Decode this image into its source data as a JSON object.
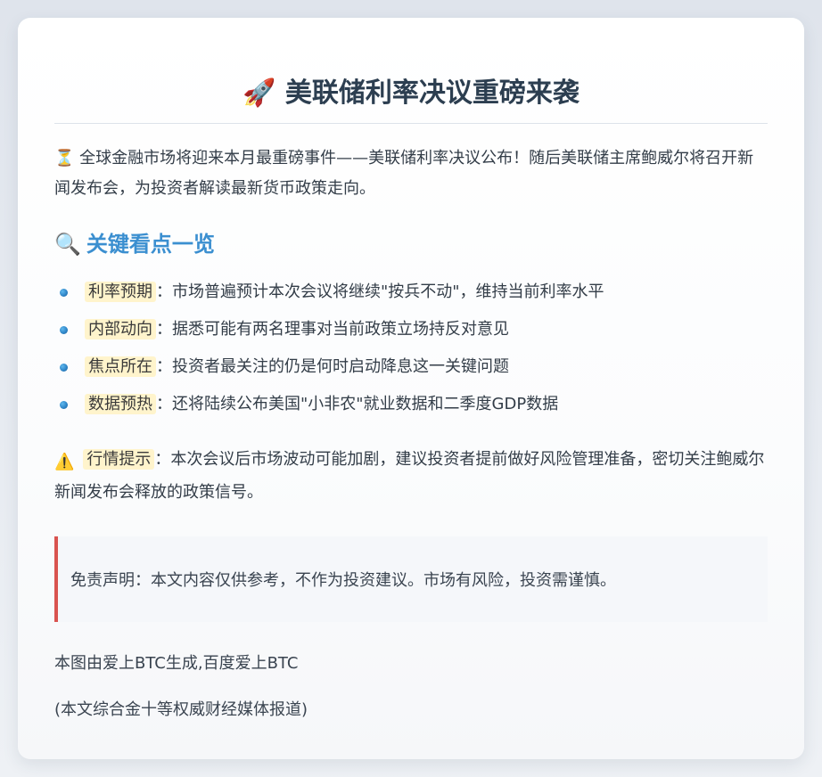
{
  "article": {
    "title_icon": "rocket-icon",
    "title_emoji": "🚀",
    "title": "美联储利率决议重磅来袭",
    "intro_icon": "hourglass-icon",
    "intro_emoji": "⏳",
    "intro": "全球金融市场将迎来本月最重磅事件——美联储利率决议公布！随后美联储主席鲍威尔将召开新闻发布会，为投资者解读最新货币政策走向。",
    "section_icon": "magnifier-icon",
    "section_emoji": "🔍",
    "section_heading": "关键看点一览",
    "key_points": [
      {
        "label": "利率预期",
        "text": "：市场普遍预计本次会议将继续\"按兵不动\"，维持当前利率水平"
      },
      {
        "label": "内部动向",
        "text": "：据悉可能有两名理事对当前政策立场持反对意见"
      },
      {
        "label": "焦点所在",
        "text": "：投资者最关注的仍是何时启动降息这一关键问题"
      },
      {
        "label": "数据预热",
        "text": "：还将陆续公布美国\"小非农\"就业数据和二季度GDP数据"
      }
    ],
    "warning_icon": "warning-icon",
    "warning_emoji": "⚠️",
    "warning_label": "行情提示",
    "warning_text": "：本次会议后市场波动可能加剧，建议投资者提前做好风险管理准备，密切关注鲍威尔新闻发布会释放的政策信号。",
    "disclaimer": "免责声明：本文内容仅供参考，不作为投资建议。市场有风险，投资需谨慎。",
    "source_line": "本图由爱上BTC生成,百度爱上BTC",
    "media_line": "(本文综合金十等权威财经媒体报道)"
  },
  "colors": {
    "title": "#2c3e50",
    "section_heading": "#3b8fd0",
    "tag_highlight": "#fff4cc",
    "disclaimer_border": "#d9534f"
  }
}
